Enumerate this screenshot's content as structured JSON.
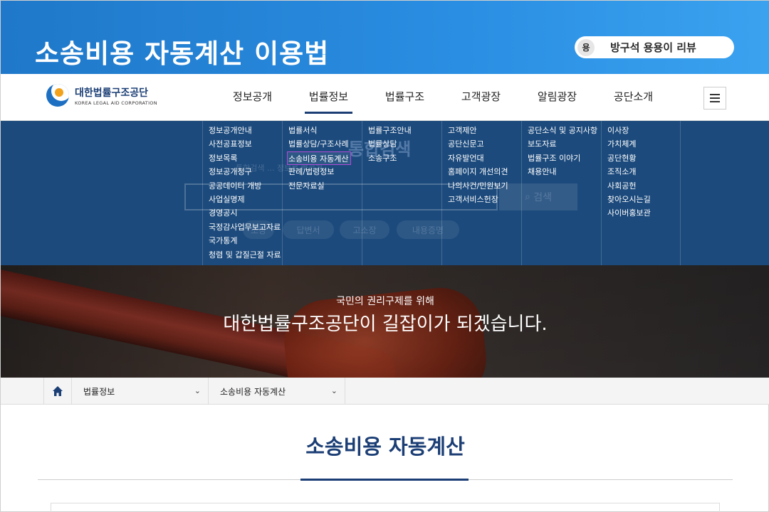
{
  "banner": {
    "title": "소송비용 자동계산 이용법",
    "badge_icon": "용",
    "badge_text": "방구석 용용이 리뷰"
  },
  "header": {
    "logo_ko": "대한법률구조공단",
    "logo_en": "KOREA LEGAL AID CORPORATION",
    "nav": [
      "정보공개",
      "법률정보",
      "법률구조",
      "고객광장",
      "알림광장",
      "공단소개"
    ],
    "active_nav": "법률정보"
  },
  "mega_menu": {
    "columns": [
      [
        "정보공개안내",
        "사전공표정보",
        "정보목록",
        "정보공개청구",
        "공공데이터 개방",
        "사업실명제",
        "경영공시",
        "국정감사업무보고자료",
        "국가통계",
        "청렴 및 갑질근절 자료"
      ],
      [
        "법률서식",
        "법률상담/구조사례",
        "소송비용 자동계산",
        "판례/법령정보",
        "전문자료실"
      ],
      [
        "법률구조안내",
        "법률상담",
        "소송구조"
      ],
      [
        "고객제안",
        "공단신문고",
        "자유발언대",
        "홈페이지 개선의견",
        "나의사건/민원보기",
        "고객서비스헌장"
      ],
      [
        "공단소식 및 공지사항",
        "보도자료",
        "법률구조 이야기",
        "채용안내"
      ],
      [
        "이사장",
        "가치체계",
        "공단현황",
        "조직소개",
        "사회공헌",
        "찾아오시는길",
        "사이버홍보관"
      ]
    ],
    "active_item": "소송비용 자동계산",
    "behind": {
      "title": "통합검색",
      "description": "통합검색 ... 정보를 빠르게 ...",
      "search_button": "검색",
      "tags": [
        "소장",
        "답변서",
        "고소장",
        "내용증명"
      ]
    }
  },
  "hero": {
    "subtitle": "국민의 권리구제를 위해",
    "headline": "대한법률구조공단이 길잡이가 되겠습니다."
  },
  "breadcrumb": {
    "level1": "법률정보",
    "level2": "소송비용 자동계산"
  },
  "page": {
    "title": "소송비용 자동계산"
  },
  "colors": {
    "banner": "#2a8ee2",
    "navy": "#1b3e75",
    "mega_bg": "#1c4a7c",
    "highlight_border": "#b24bd8"
  }
}
